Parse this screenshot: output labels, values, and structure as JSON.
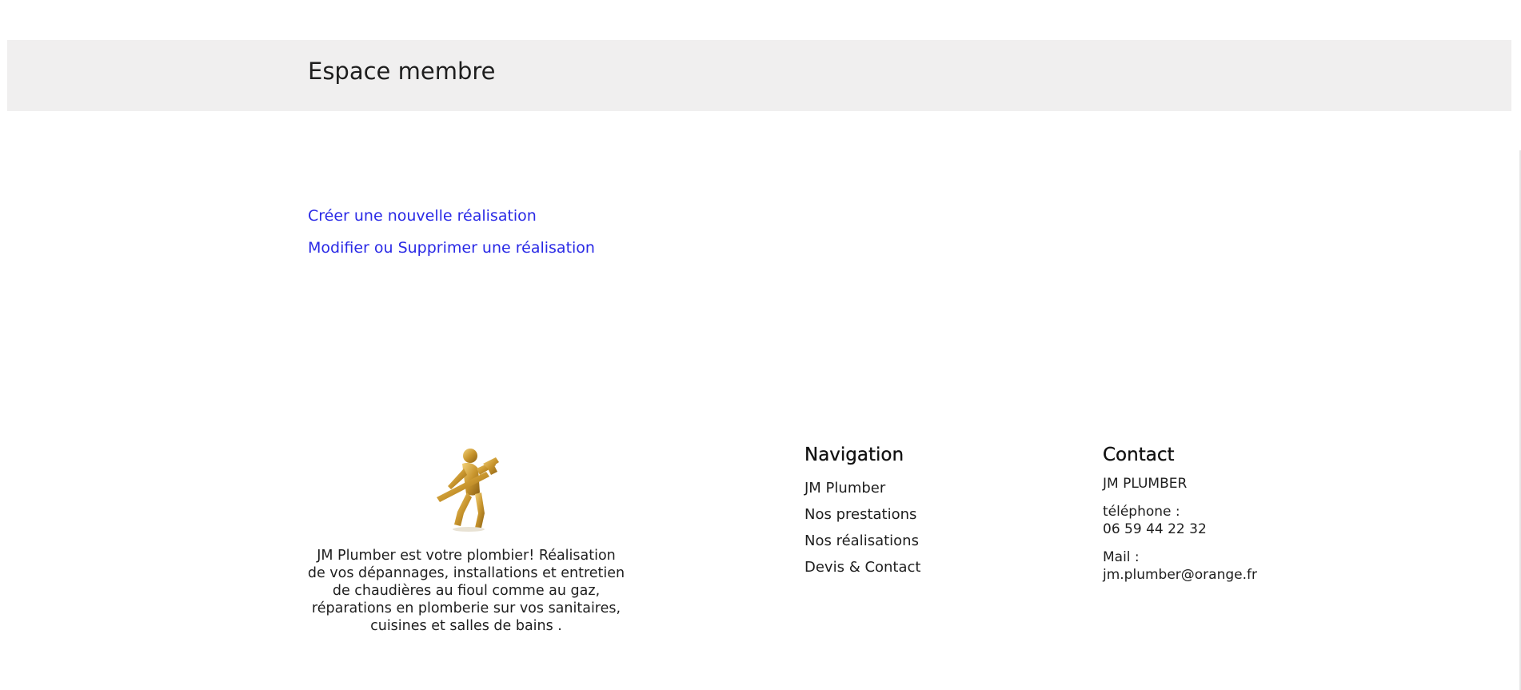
{
  "page": {
    "title": "Espace membre"
  },
  "actions": {
    "create_label": "Créer une nouvelle réalisation",
    "edit_label": "Modifier ou Supprimer une réalisation"
  },
  "footer": {
    "logo_icon": "golden-plumber-with-wrench-icon",
    "about_text": "JM Plumber est votre plombier! Réalisation de vos dépannages, installations et entretien de chaudières au fioul comme au gaz, réparations en plomberie sur vos sanitaires, cuisines et salles de bains .",
    "navigation": {
      "heading": "Navigation",
      "items": [
        {
          "label": "JM Plumber"
        },
        {
          "label": "Nos prestations"
        },
        {
          "label": "Nos réalisations"
        },
        {
          "label": "Devis & Contact"
        }
      ]
    },
    "contact": {
      "heading": "Contact",
      "company": "JM PLUMBER",
      "phone_label": "téléphone :",
      "phone": "06 59 44 22 32",
      "mail_label": "Mail :",
      "mail": "jm.plumber@orange.fr"
    }
  },
  "colors": {
    "banner_bg": "#f0efef",
    "link": "#2a2ae6",
    "logo_gold": "#c9962e"
  }
}
